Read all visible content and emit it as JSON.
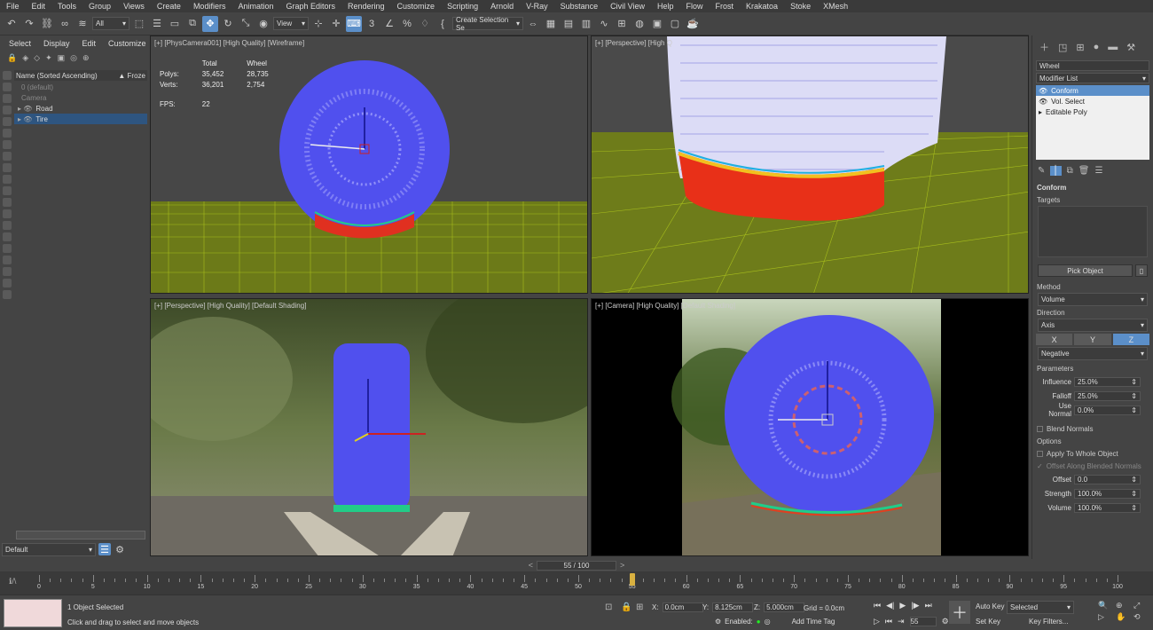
{
  "menu": [
    "File",
    "Edit",
    "Tools",
    "Group",
    "Views",
    "Create",
    "Modifiers",
    "Animation",
    "Graph Editors",
    "Rendering",
    "Customize",
    "Scripting",
    "Arnold",
    "V-Ray",
    "Substance",
    "Civil View",
    "Help",
    "Flow",
    "Frost",
    "Krakatoa",
    "Stoke",
    "XMesh"
  ],
  "toolbar": {
    "filter": "All",
    "ref_coord": "View",
    "selection_set": "Create Selection Se"
  },
  "scene": {
    "tabs": [
      "Select",
      "Display",
      "Edit",
      "Customize"
    ],
    "col_name": "Name (Sorted Ascending)",
    "col_frozen": "▲ Froze",
    "items": [
      {
        "label": "0 (default)",
        "dim": true
      },
      {
        "label": "Camera",
        "dim": true
      },
      {
        "label": "Road",
        "dim": false
      },
      {
        "label": "Tire",
        "dim": false
      }
    ],
    "layer": "Default"
  },
  "viewports": {
    "top_left": {
      "label": "[+] [PhysCamera001] [High Quality] [Wireframe]",
      "stats": {
        "h_total": "Total",
        "h_wheel": "Wheel",
        "polys_lbl": "Polys:",
        "polys_total": "35,452",
        "polys_wheel": "28,735",
        "verts_lbl": "Verts:",
        "verts_total": "36,201",
        "verts_wheel": "2,754",
        "fps_lbl": "FPS:",
        "fps": "22"
      }
    },
    "top_right": {
      "label": "[+] [Perspective] [High Q"
    },
    "bottom_left": {
      "label": "[+] [Perspective] [High Quality] [Default Shading]"
    },
    "bottom_right": {
      "label": "[+] [Camera] [High Quality] [Default Shading]"
    }
  },
  "command": {
    "object_name": "Wheel",
    "modifier_list": "Modifier List",
    "stack": [
      {
        "label": "Conform",
        "sel": true
      },
      {
        "label": "Vol. Select",
        "sel": false
      },
      {
        "label": "Editable Poly",
        "sel": false
      }
    ],
    "rollout_title": "Conform",
    "targets": "Targets",
    "pick_object": "Pick Object",
    "method_lbl": "Method",
    "method": "Volume",
    "direction_lbl": "Direction",
    "direction": "Axis",
    "axes": [
      "X",
      "Y",
      "Z"
    ],
    "axis_active": "Z",
    "negative": "Negative",
    "parameters": "Parameters",
    "influence_lbl": "Influence",
    "influence": "25.0%",
    "falloff_lbl": "Falloff",
    "falloff": "25.0%",
    "use_normal_lbl": "Use Normal",
    "use_normal": "0.0%",
    "blend_normals": "Blend Normals",
    "options": "Options",
    "apply_whole": "Apply To Whole Object",
    "offset_blended": "Offset Along Blended Normals",
    "offset_lbl": "Offset",
    "offset": "0.0",
    "strength_lbl": "Strength",
    "strength": "100.0%",
    "volume_lbl": "Volume",
    "volume": "100.0%"
  },
  "timeline": {
    "frame": "55 / 100",
    "ticks": [
      "0",
      "5",
      "10",
      "15",
      "20",
      "25",
      "30",
      "35",
      "40",
      "45",
      "50",
      "55",
      "60",
      "65",
      "70",
      "75",
      "80",
      "85",
      "90",
      "95",
      "100"
    ],
    "current": 55,
    "max": 100
  },
  "status": {
    "selected": "1 Object Selected",
    "hint": "Click and drag to select and move objects",
    "x_lbl": "X:",
    "x": "0.0cm",
    "y_lbl": "Y:",
    "y": "8.125cm",
    "z_lbl": "Z:",
    "z": "5.000cm",
    "grid": "Grid = 0.0cm",
    "enabled": "Enabled:",
    "add_time_tag": "Add Time Tag",
    "auto_key": "Auto Key",
    "set_key": "Set Key",
    "selected_dd": "Selected",
    "key_filters": "Key Filters...",
    "frame_field": "55"
  },
  "colors": {
    "accent": "#5b8fc9",
    "mesh": "#4c4ce6",
    "grid": "#a8c418"
  }
}
